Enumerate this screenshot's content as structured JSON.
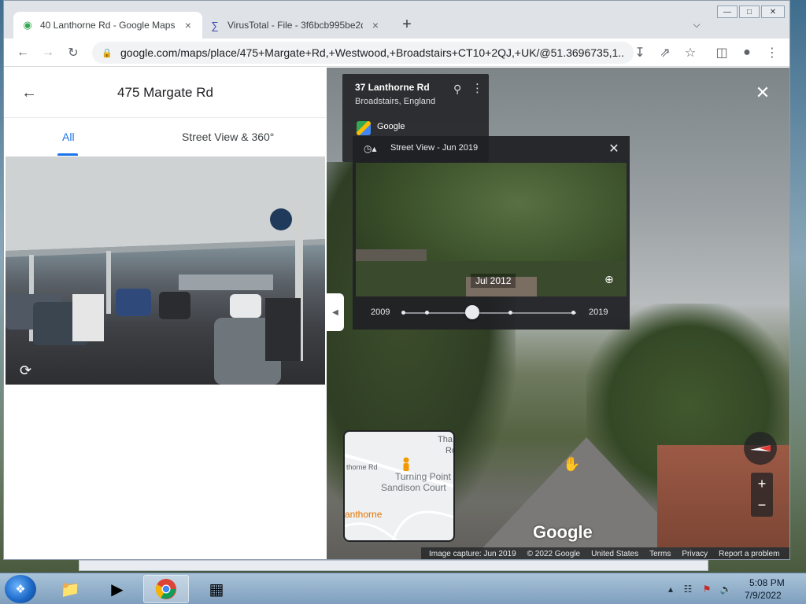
{
  "browser": {
    "tabs": [
      {
        "label": "40 Lanthorne Rd - Google Maps",
        "icon": "map-pin-icon",
        "active": true
      },
      {
        "label": "VirusTotal - File - 3f6bcb995be2d",
        "icon": "virustotal-icon",
        "active": false
      }
    ],
    "new_tab": "+",
    "url": "google.com/maps/place/475+Margate+Rd,+Westwood,+Broadstairs+CT10+2QJ,+UK/@51.3696735,1...."
  },
  "left_panel": {
    "title": "475 Margate Rd",
    "tabs": [
      "All",
      "Street View & 360°"
    ]
  },
  "street_view": {
    "address": {
      "title": "37 Lanthorne Rd",
      "subtitle": "Broadstairs, England",
      "source": "Google"
    },
    "time_machine": {
      "title": "Street View - Jun 2019",
      "preview_date": "Jul 2012",
      "start_year": "2009",
      "end_year": "2019",
      "selected_fraction": 0.4
    },
    "minimap": {
      "labels": [
        "Tha",
        "Rd",
        "thorne Rd",
        "Turning Point",
        "Sandison Court",
        "anthorne"
      ]
    },
    "watermark": "Google",
    "footer": [
      "Image capture: Jun 2019",
      "© 2022 Google",
      "United States",
      "Terms",
      "Privacy",
      "Report a problem"
    ]
  },
  "taskbar": {
    "time": "5:08 PM",
    "date": "7/9/2022"
  },
  "colors": {
    "accent": "#1a73e8",
    "dark_panel": "#202124"
  }
}
